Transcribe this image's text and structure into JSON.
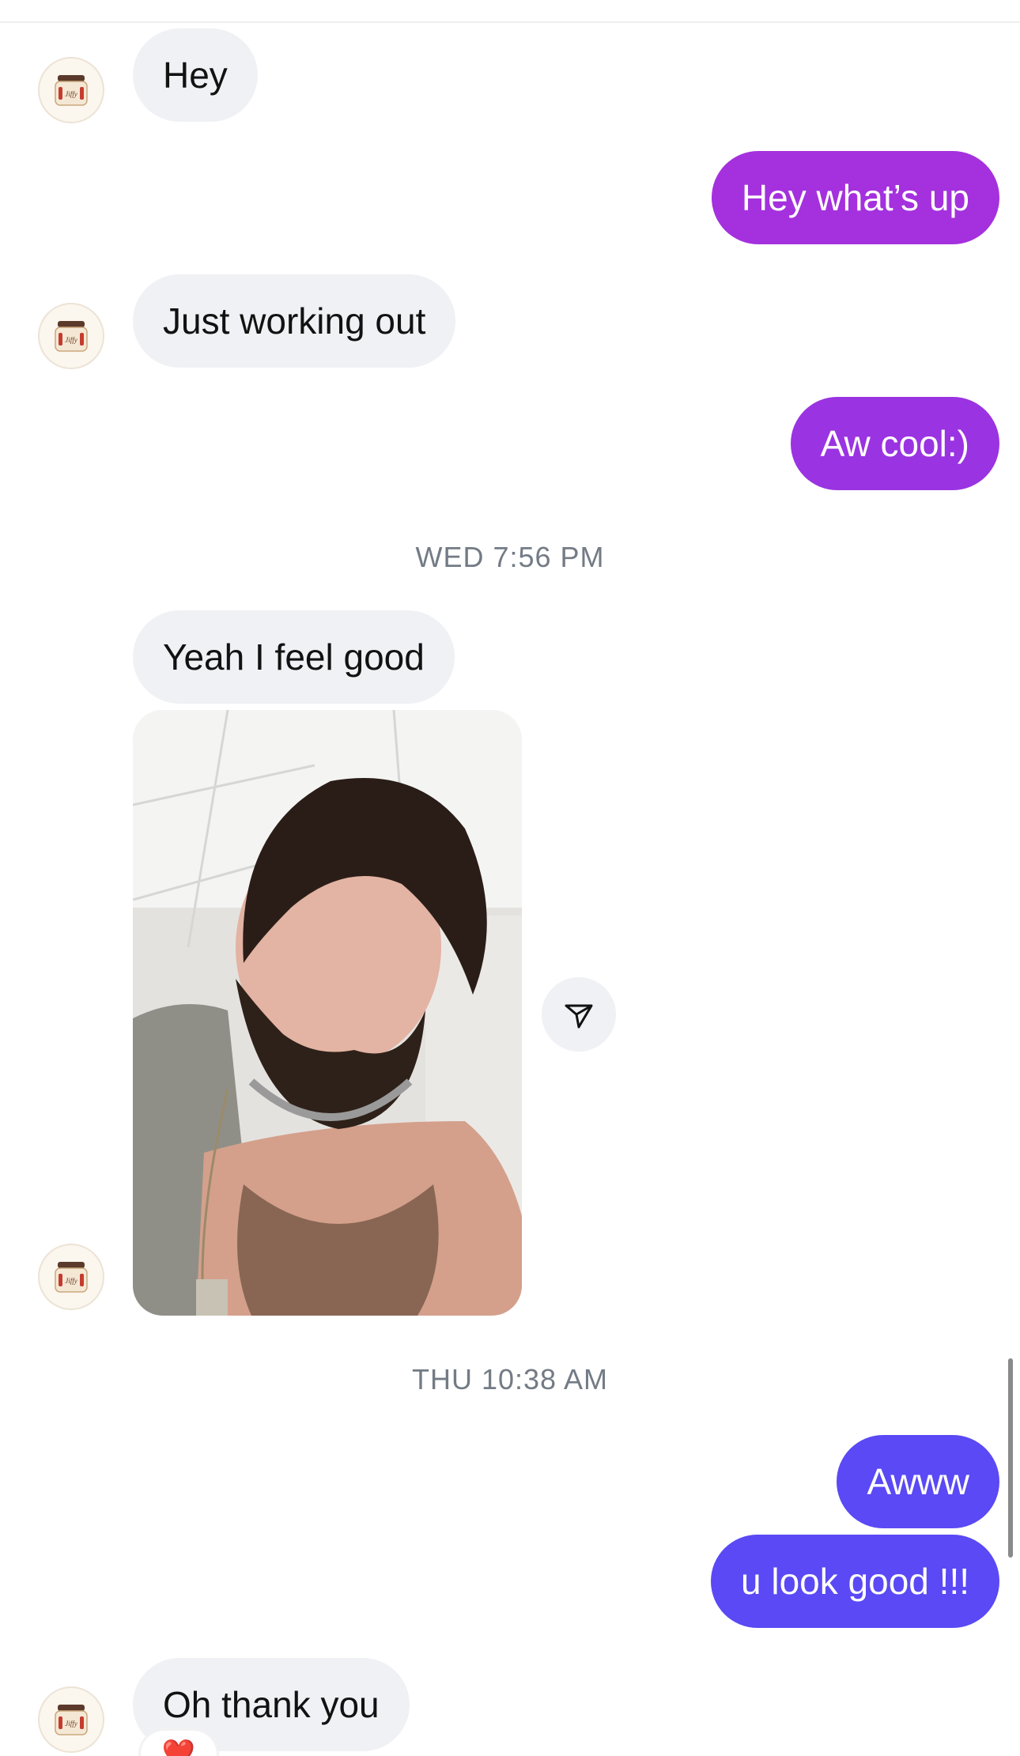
{
  "contact": {
    "avatar_logo_text": "Jiffy"
  },
  "messages": {
    "m1": "Hey",
    "m2": "Hey what’s up",
    "m3": "Just working out",
    "m4": "Aw cool:)",
    "m5": "Yeah I feel good",
    "m6": "Awww",
    "m7": "u look good !!!",
    "m8": "Oh thank you"
  },
  "timestamps": {
    "t1": "WED 7:56 PM",
    "t2": "THU 10:38 AM"
  },
  "reaction": {
    "emoji": "❤️",
    "icon": "heart-icon"
  },
  "icons": {
    "share": "send-icon"
  },
  "colors": {
    "incoming_bubble": "#eff1f4",
    "outgoing_purple_top": "#a431dd",
    "outgoing_purple_mid": "#9a33e1",
    "outgoing_blue": "#5a49f4",
    "timestamp_text": "#737b85"
  }
}
